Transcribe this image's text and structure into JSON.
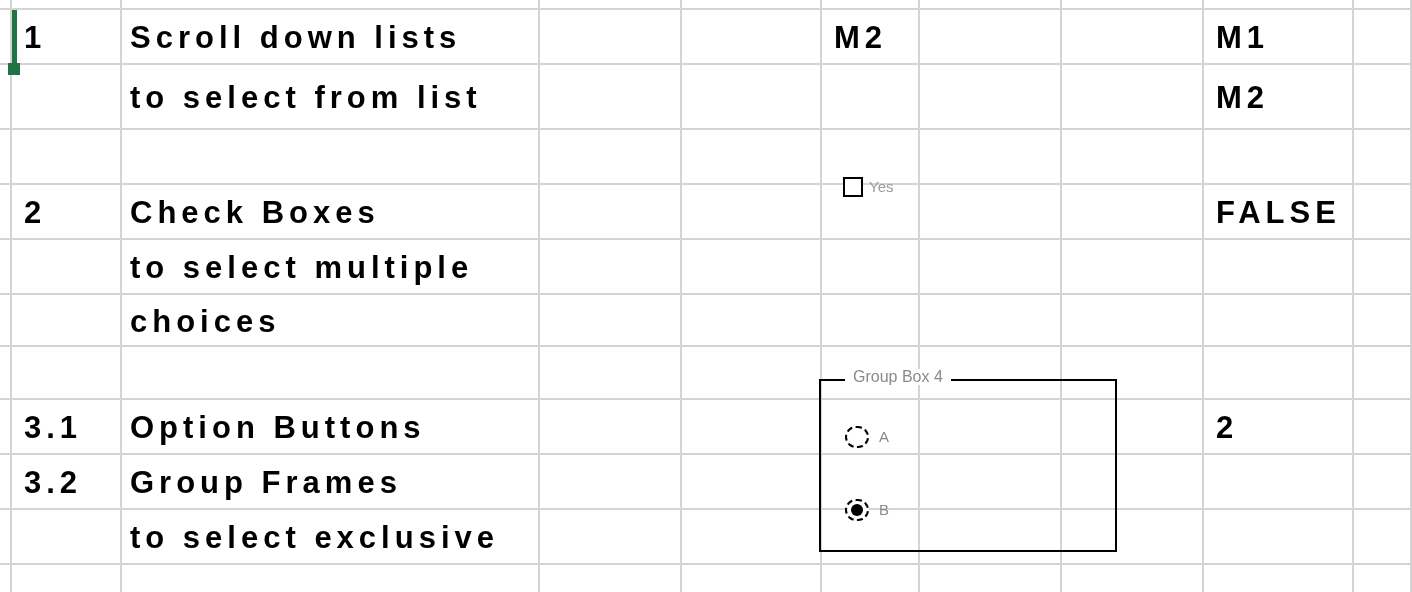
{
  "rows": [
    {
      "column_a": "1",
      "column_b": "Scroll down lists",
      "column_f": "M2",
      "column_i": "M1",
      "selected": true
    },
    {
      "column_b": "to select from list",
      "column_i": "M2",
      "selected": false
    },
    {
      "selected": false
    },
    {
      "column_a": "2",
      "column_b": "Check Boxes",
      "column_i": "FALSE",
      "selected": false
    },
    {
      "column_b": "to select multiple",
      "selected": false
    },
    {
      "column_b": "choices",
      "selected": false
    },
    {
      "selected": false
    },
    {
      "column_a": "3.1",
      "column_b": "Option Buttons",
      "column_i": "2",
      "selected": false
    },
    {
      "column_a": "3.2",
      "column_b": "Group Frames",
      "selected": false
    },
    {
      "column_b": "to select exclusive",
      "selected": false
    }
  ],
  "checkbox": {
    "label": "Yes",
    "checked": false
  },
  "group_box": {
    "title": "Group Box 4",
    "options": [
      {
        "label": "A",
        "selected": false
      },
      {
        "label": "B",
        "selected": true
      }
    ]
  }
}
